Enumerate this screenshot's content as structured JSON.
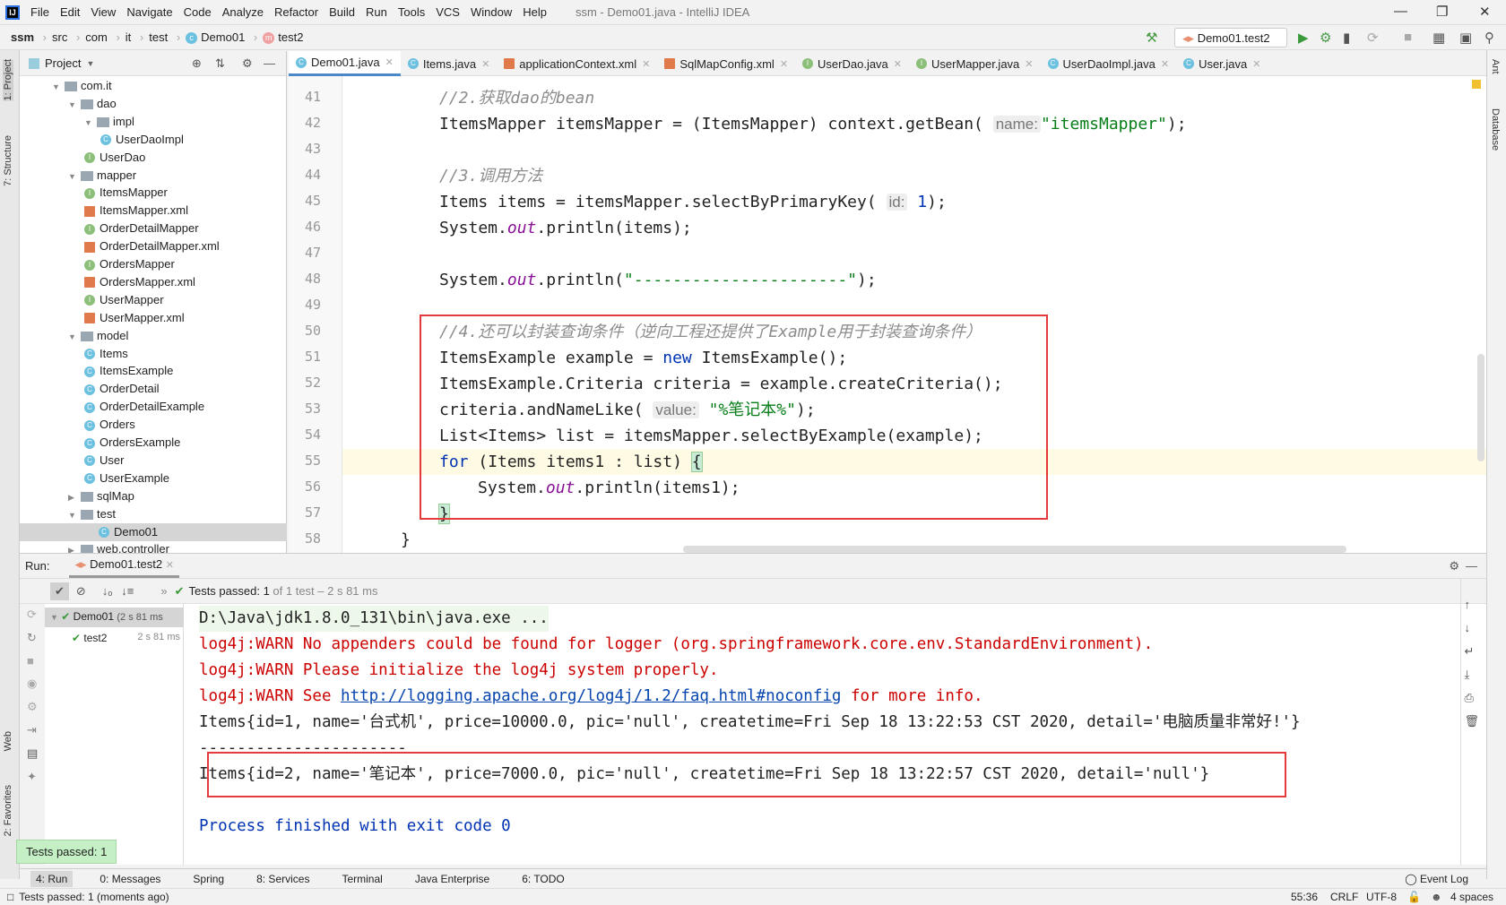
{
  "app": {
    "logo": "IJ",
    "title": "ssm - Demo01.java - IntelliJ IDEA"
  },
  "menu": [
    "File",
    "Edit",
    "View",
    "Navigate",
    "Code",
    "Analyze",
    "Refactor",
    "Build",
    "Run",
    "Tools",
    "VCS",
    "Window",
    "Help"
  ],
  "breadcrumb": [
    "ssm",
    "src",
    "com",
    "it",
    "test",
    "Demo01",
    "test2"
  ],
  "run_config": "Demo01.test2",
  "left_stripe": [
    "1: Project",
    "7: Structure",
    "Web",
    "2: Favorites"
  ],
  "right_stripe": [
    "Ant",
    "Database"
  ],
  "project": {
    "title": "Project",
    "tree": [
      {
        "label": "com.it",
        "depth": 0,
        "type": "folder",
        "open": true
      },
      {
        "label": "dao",
        "depth": 1,
        "type": "folder",
        "open": true
      },
      {
        "label": "impl",
        "depth": 2,
        "type": "folder",
        "open": true
      },
      {
        "label": "UserDaoImpl",
        "depth": 3,
        "type": "c"
      },
      {
        "label": "UserDao",
        "depth": 2,
        "type": "i"
      },
      {
        "label": "mapper",
        "depth": 1,
        "type": "folder",
        "open": true
      },
      {
        "label": "ItemsMapper",
        "depth": 2,
        "type": "i"
      },
      {
        "label": "ItemsMapper.xml",
        "depth": 2,
        "type": "x"
      },
      {
        "label": "OrderDetailMapper",
        "depth": 2,
        "type": "i"
      },
      {
        "label": "OrderDetailMapper.xml",
        "depth": 2,
        "type": "x"
      },
      {
        "label": "OrdersMapper",
        "depth": 2,
        "type": "i"
      },
      {
        "label": "OrdersMapper.xml",
        "depth": 2,
        "type": "x"
      },
      {
        "label": "UserMapper",
        "depth": 2,
        "type": "i"
      },
      {
        "label": "UserMapper.xml",
        "depth": 2,
        "type": "x"
      },
      {
        "label": "model",
        "depth": 1,
        "type": "folder",
        "open": true
      },
      {
        "label": "Items",
        "depth": 2,
        "type": "c"
      },
      {
        "label": "ItemsExample",
        "depth": 2,
        "type": "c"
      },
      {
        "label": "OrderDetail",
        "depth": 2,
        "type": "c"
      },
      {
        "label": "OrderDetailExample",
        "depth": 2,
        "type": "c"
      },
      {
        "label": "Orders",
        "depth": 2,
        "type": "c"
      },
      {
        "label": "OrdersExample",
        "depth": 2,
        "type": "c"
      },
      {
        "label": "User",
        "depth": 2,
        "type": "c"
      },
      {
        "label": "UserExample",
        "depth": 2,
        "type": "c"
      },
      {
        "label": "sqlMap",
        "depth": 1,
        "type": "folder",
        "open": false
      },
      {
        "label": "test",
        "depth": 1,
        "type": "folder",
        "open": true
      },
      {
        "label": "Demo01",
        "depth": 2,
        "type": "c",
        "selected": true
      },
      {
        "label": "web.controller",
        "depth": 1,
        "type": "folder",
        "open": false
      }
    ]
  },
  "tabs": [
    {
      "label": "Demo01.java",
      "icon": "c",
      "active": true
    },
    {
      "label": "Items.java",
      "icon": "c"
    },
    {
      "label": "applicationContext.xml",
      "icon": "x"
    },
    {
      "label": "SqlMapConfig.xml",
      "icon": "x"
    },
    {
      "label": "UserDao.java",
      "icon": "i"
    },
    {
      "label": "UserMapper.java",
      "icon": "i"
    },
    {
      "label": "UserDaoImpl.java",
      "icon": "c"
    },
    {
      "label": "User.java",
      "icon": "c"
    }
  ],
  "editor": {
    "current_line": 55,
    "lines": [
      {
        "n": "41",
        "indent": 0,
        "t": [
          [
            "//2.获取dao的bean",
            "c"
          ]
        ]
      },
      {
        "n": "42",
        "indent": 0,
        "t": [
          [
            "ItemsMapper itemsMapper = (ItemsMapper) context.getBean( ",
            ""
          ],
          [
            "name:",
            "hint"
          ],
          [
            "\"itemsMapper\"",
            "s"
          ],
          [
            ");",
            ""
          ]
        ]
      },
      {
        "n": "43",
        "indent": 0,
        "t": []
      },
      {
        "n": "44",
        "indent": 0,
        "t": [
          [
            "//3.调用方法",
            "c"
          ]
        ]
      },
      {
        "n": "45",
        "indent": 0,
        "t": [
          [
            "Items items = itemsMapper.selectByPrimaryKey( ",
            ""
          ],
          [
            "id:",
            "hint"
          ],
          [
            " 1",
            "k"
          ],
          [
            ");",
            ""
          ]
        ]
      },
      {
        "n": "46",
        "indent": 0,
        "t": [
          [
            "System.",
            ""
          ],
          [
            "out",
            "f"
          ],
          [
            ".println(items);",
            ""
          ]
        ]
      },
      {
        "n": "47",
        "indent": 0,
        "t": []
      },
      {
        "n": "48",
        "indent": 0,
        "t": [
          [
            "System.",
            ""
          ],
          [
            "out",
            "f"
          ],
          [
            ".println(",
            ""
          ],
          [
            "\"----------------------\"",
            "s"
          ],
          [
            ");",
            ""
          ]
        ]
      },
      {
        "n": "49",
        "indent": 0,
        "t": []
      },
      {
        "n": "50",
        "indent": 0,
        "t": [
          [
            "//4.还可以封装查询条件（逆向工程还提供了Example用于封装查询条件）",
            "c"
          ]
        ]
      },
      {
        "n": "51",
        "indent": 0,
        "t": [
          [
            "ItemsExample example = ",
            ""
          ],
          [
            "new",
            "k"
          ],
          [
            " ItemsExample();",
            ""
          ]
        ]
      },
      {
        "n": "52",
        "indent": 0,
        "t": [
          [
            "ItemsExample.Criteria criteria = example.createCriteria();",
            ""
          ]
        ]
      },
      {
        "n": "53",
        "indent": 0,
        "t": [
          [
            "criteria.andNameLike( ",
            ""
          ],
          [
            "value:",
            "hint"
          ],
          [
            " \"%笔记本%\"",
            "s"
          ],
          [
            ");",
            ""
          ]
        ]
      },
      {
        "n": "54",
        "indent": 0,
        "t": [
          [
            "List<Items> list = itemsMapper.selectByExample(example);",
            ""
          ]
        ]
      },
      {
        "n": "55",
        "indent": 0,
        "t": [
          [
            "for",
            "k"
          ],
          [
            " (Items items1 : list) ",
            ""
          ],
          [
            "{",
            "bm"
          ]
        ]
      },
      {
        "n": "56",
        "indent": 1,
        "t": [
          [
            "System.",
            ""
          ],
          [
            "out",
            "f"
          ],
          [
            ".println(items1);",
            ""
          ]
        ]
      },
      {
        "n": "57",
        "indent": 0,
        "t": [
          [
            "}",
            "bm"
          ]
        ]
      },
      {
        "n": "58",
        "indent": -1,
        "t": [
          [
            "}",
            ""
          ]
        ]
      }
    ]
  },
  "run": {
    "label": "Run:",
    "tab": "Demo01.test2",
    "summary_bold": "Tests passed: 1",
    "summary_rest": " of 1 test – 2 s 81 ms",
    "tests": [
      {
        "name": "Demo01",
        "time": "2 s 81 ms"
      },
      {
        "name": "test2",
        "time": "2 s 81 ms"
      }
    ],
    "console": [
      {
        "text": "D:\\Java\\jdk1.8.0_131\\bin\\java.exe ...",
        "cls": "cmd"
      },
      {
        "text": "log4j:WARN No appenders could be found for logger (org.springframework.core.env.StandardEnvironment).",
        "cls": "red"
      },
      {
        "text": "log4j:WARN Please initialize the log4j system properly.",
        "cls": "red"
      },
      {
        "text": "log4j:WARN See ",
        "cls": "red",
        "link": "http://logging.apache.org/log4j/1.2/faq.html#noconfig",
        "after": " for more info."
      },
      {
        "text": "Items{id=1, name='台式机', price=10000.0, pic='null', createtime=Fri Sep 18 13:22:53 CST 2020, detail='电脑质量非常好!'}",
        "cls": ""
      },
      {
        "text": "----------------------",
        "cls": ""
      },
      {
        "text": "Items{id=2, name='笔记本', price=7000.0, pic='null', createtime=Fri Sep 18 13:22:57 CST 2020, detail='null'}",
        "cls": ""
      },
      {
        "text": "",
        "cls": ""
      },
      {
        "text": "Process finished with exit code 0",
        "cls": "blue"
      }
    ]
  },
  "popup": "Tests passed: 1",
  "tool_windows": [
    "4: Run",
    "0: Messages",
    "Spring",
    "8: Services",
    "Terminal",
    "Java Enterprise",
    "6: TODO"
  ],
  "event_log": "Event Log",
  "status": {
    "message": "Tests passed: 1 (moments ago)",
    "position": "55:36",
    "line_sep": "CRLF",
    "encoding": "UTF-8",
    "indent": "4 spaces"
  }
}
